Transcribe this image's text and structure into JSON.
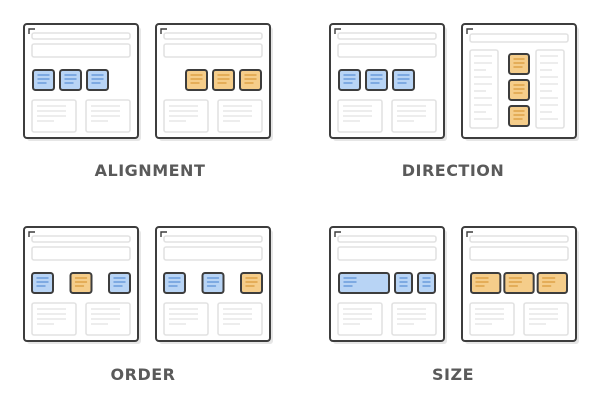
{
  "colors": {
    "frame": "#3d3d3d",
    "placeholder": "#e2e2e2",
    "shadow": "#e6e6e6",
    "blue_fill": "#b8d4f5",
    "blue_line": "#5b91d6",
    "orange_fill": "#f5cd8a",
    "orange_line": "#d99a3a",
    "label": "#5a5a5a"
  },
  "labels": {
    "alignment": "ALIGNMENT",
    "direction": "DIRECTION",
    "order": "ORDER",
    "size": "SIZE"
  },
  "panels": [
    {
      "group": "alignment",
      "layout": "row",
      "justify": "start",
      "items": [
        {
          "c": "blue",
          "w": 1
        },
        {
          "c": "blue",
          "w": 1
        },
        {
          "c": "blue",
          "w": 1
        }
      ]
    },
    {
      "group": "alignment",
      "layout": "row",
      "justify": "end",
      "items": [
        {
          "c": "orange",
          "w": 1
        },
        {
          "c": "orange",
          "w": 1
        },
        {
          "c": "orange",
          "w": 1
        }
      ]
    },
    {
      "group": "direction",
      "layout": "row",
      "justify": "start",
      "items": [
        {
          "c": "blue",
          "w": 1
        },
        {
          "c": "blue",
          "w": 1
        },
        {
          "c": "blue",
          "w": 1
        }
      ]
    },
    {
      "group": "direction",
      "layout": "column",
      "justify": "center",
      "items": [
        {
          "c": "orange",
          "w": 1
        },
        {
          "c": "orange",
          "w": 1
        },
        {
          "c": "orange",
          "w": 1
        }
      ]
    },
    {
      "group": "order",
      "layout": "row",
      "justify": "between",
      "items": [
        {
          "c": "blue",
          "w": 1
        },
        {
          "c": "orange",
          "w": 1
        },
        {
          "c": "blue",
          "w": 1
        }
      ]
    },
    {
      "group": "order",
      "layout": "row",
      "justify": "between",
      "items": [
        {
          "c": "blue",
          "w": 1
        },
        {
          "c": "blue",
          "w": 1
        },
        {
          "c": "orange",
          "w": 1
        }
      ]
    },
    {
      "group": "size",
      "layout": "row",
      "justify": "start",
      "items": [
        {
          "c": "blue",
          "w": 3
        },
        {
          "c": "blue",
          "w": 0.8
        },
        {
          "c": "blue",
          "w": 0.8
        }
      ]
    },
    {
      "group": "size",
      "layout": "row",
      "justify": "stretch",
      "items": [
        {
          "c": "orange",
          "w": 1
        },
        {
          "c": "orange",
          "w": 1
        },
        {
          "c": "orange",
          "w": 1
        }
      ]
    }
  ]
}
